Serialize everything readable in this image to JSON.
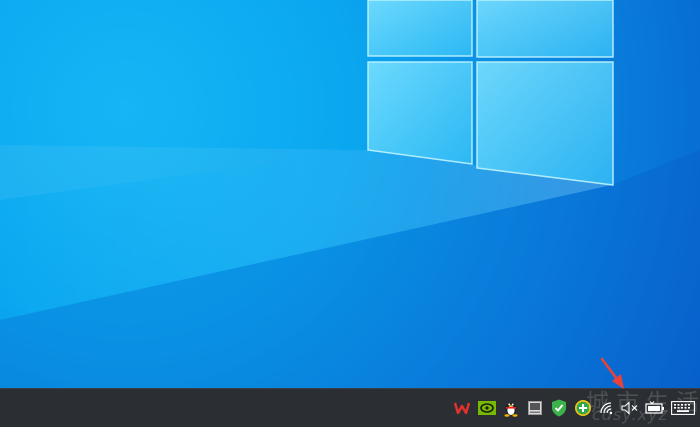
{
  "desktop": {
    "wallpaper": "windows-10-hero-light",
    "accent_color": "#0a84e0"
  },
  "taskbar": {
    "background_color": "#2b2f33",
    "tray_icons": [
      {
        "name": "wps-office-icon"
      },
      {
        "name": "nvidia-icon"
      },
      {
        "name": "qq-penguin-icon"
      },
      {
        "name": "tablet-app-icon"
      },
      {
        "name": "security-shield-icon"
      },
      {
        "name": "green-plus-icon"
      },
      {
        "name": "wifi-icon"
      },
      {
        "name": "volume-muted-icon"
      },
      {
        "name": "battery-icon"
      },
      {
        "name": "keyboard-icon"
      }
    ]
  },
  "annotation": {
    "arrow_color": "#e8433a"
  },
  "watermark": {
    "line1": "城市生活",
    "line2": "cdsy.xyz"
  }
}
